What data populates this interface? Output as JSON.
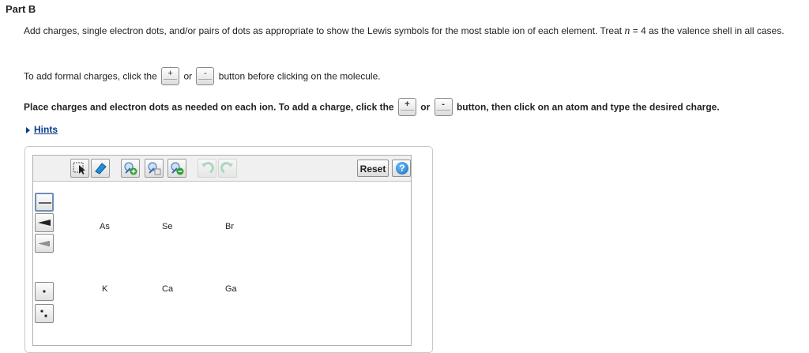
{
  "part_title": "Part B",
  "instructions": {
    "text_before": "Add charges, single electron dots, and/or pairs of dots as appropriate to show the Lewis symbols for the most stable ion of each element. Treat ",
    "n_symbol": "n",
    "equals": " = 4",
    "text_after": " as the valence shell in all cases."
  },
  "formal_charge_line": {
    "prefix": "To add formal charges, click the",
    "or": "or",
    "suffix": "button before clicking on the molecule."
  },
  "place_charges_line": {
    "prefix": "Place charges and electron dots as needed on each ion. To add a charge, click the",
    "or": "or",
    "suffix": "button, then click on an atom and type the desired charge."
  },
  "charge_buttons": {
    "plus": "+",
    "minus": "-"
  },
  "hints": {
    "label": "Hints"
  },
  "editor": {
    "reset_label": "Reset",
    "help_label": "?",
    "atoms_row1": [
      "As",
      "Se",
      "Br"
    ],
    "atoms_row2": [
      "K",
      "Ca",
      "Ga"
    ]
  },
  "colors": {
    "link": "#0a3c8c",
    "toolbar_bg": "#f0f0f0",
    "help_blue": "#1867b8"
  }
}
